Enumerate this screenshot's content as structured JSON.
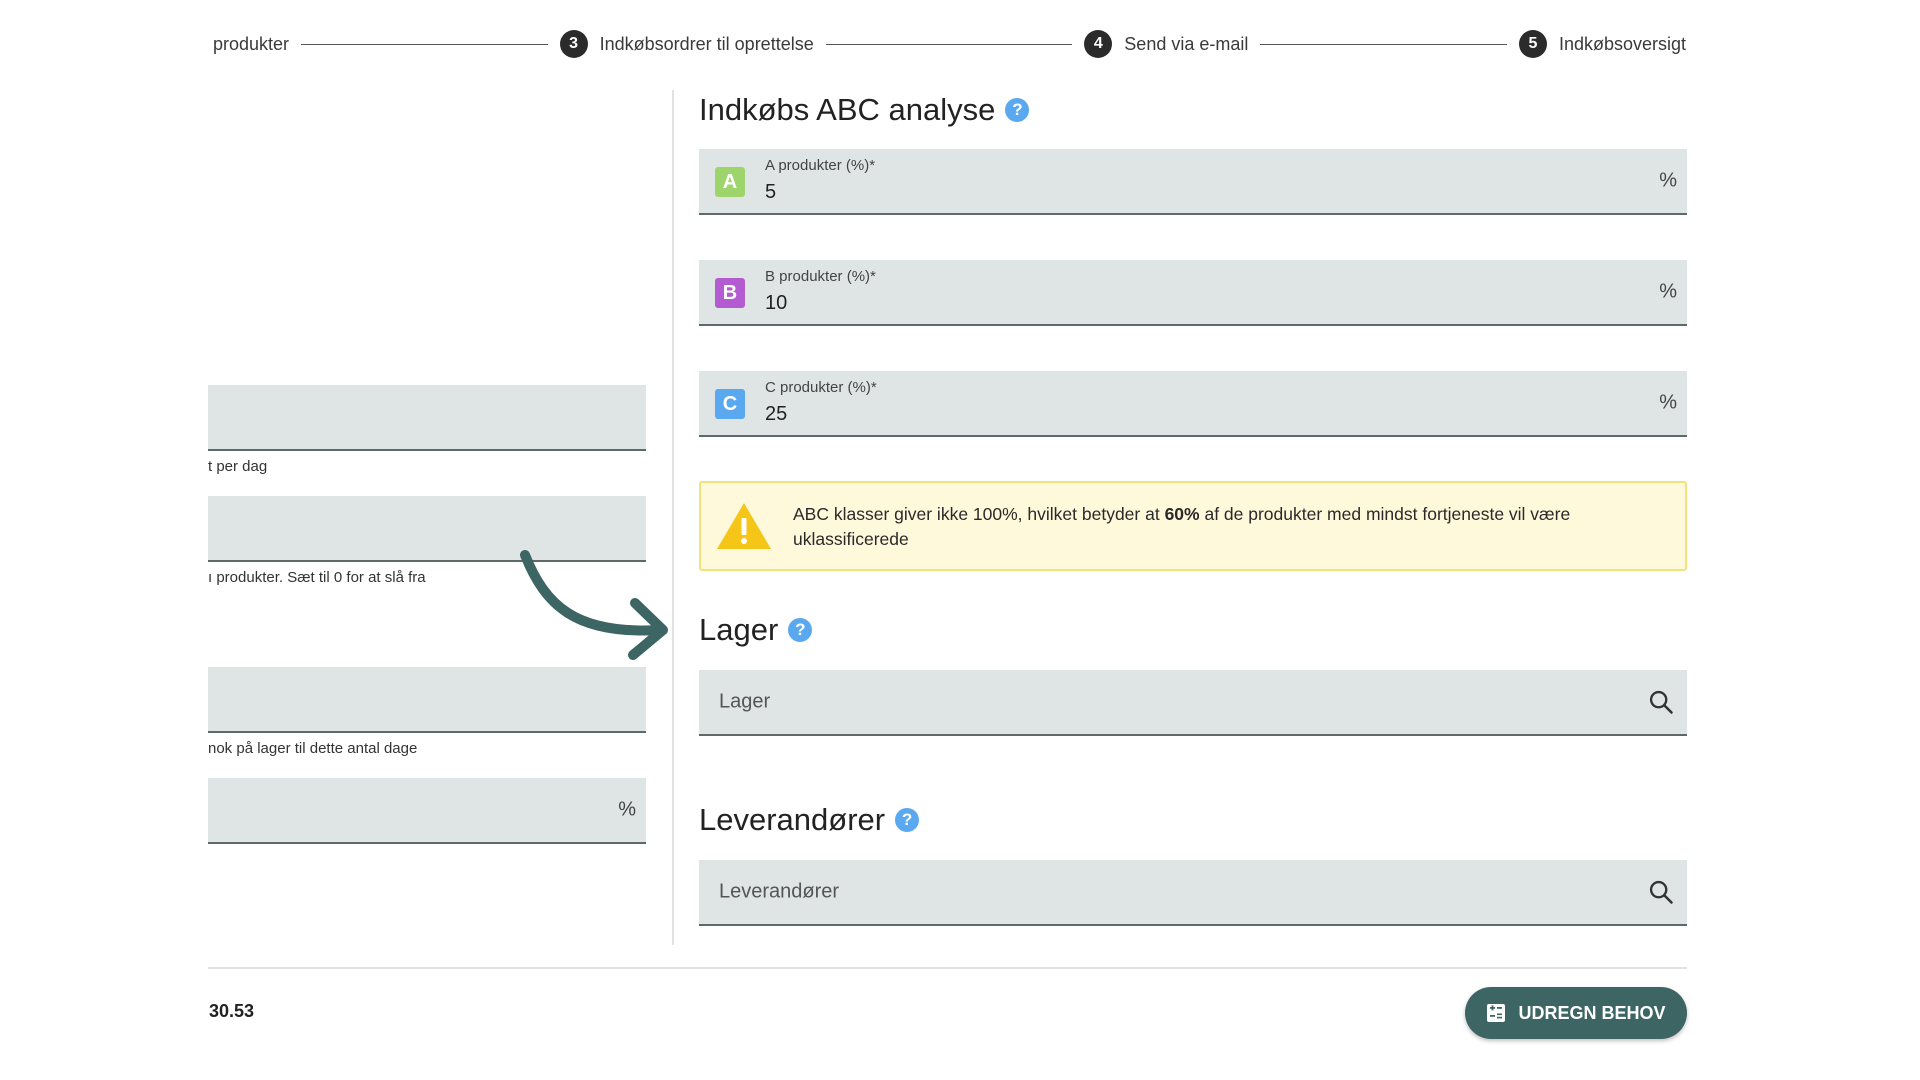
{
  "stepper": {
    "steps": [
      {
        "number": "",
        "label": "produkter"
      },
      {
        "number": "3",
        "label": "Indkøbsordrer til oprettelse"
      },
      {
        "number": "4",
        "label": "Send via e-mail"
      },
      {
        "number": "5",
        "label": "Indkøbsoversigt"
      }
    ]
  },
  "left": {
    "field1_help": "t per dag",
    "field2_help": "ı produkter. Sæt til 0 for at slå fra",
    "field3_help": "nok på lager til dette antal dage",
    "field4_suffix": "%"
  },
  "abc": {
    "title": "Indkøbs ABC analyse",
    "help": "?",
    "fields": [
      {
        "badge": "A",
        "label": "A produkter (%)*",
        "value": "5",
        "suffix": "%"
      },
      {
        "badge": "B",
        "label": "B produkter (%)*",
        "value": "10",
        "suffix": "%"
      },
      {
        "badge": "C",
        "label": "C produkter (%)*",
        "value": "25",
        "suffix": "%"
      }
    ],
    "warning": {
      "pre": "ABC klasser giver ikke 100%, hvilket betyder at ",
      "bold": "60%",
      "post": " af de produkter med mindst fortjeneste vil være uklassificerede"
    }
  },
  "lager": {
    "title": "Lager",
    "help": "?",
    "placeholder": "Lager"
  },
  "leverandorer": {
    "title": "Leverandører",
    "help": "?",
    "placeholder": "Leverandører"
  },
  "footer": {
    "value": "30.53",
    "button_label": "UDREGN BEHOV"
  },
  "colors": {
    "badge_a": "#9ed46c",
    "badge_b": "#b45bd2",
    "badge_c": "#5aa9f0",
    "button": "#3d6563",
    "arrow": "#3d6563"
  }
}
